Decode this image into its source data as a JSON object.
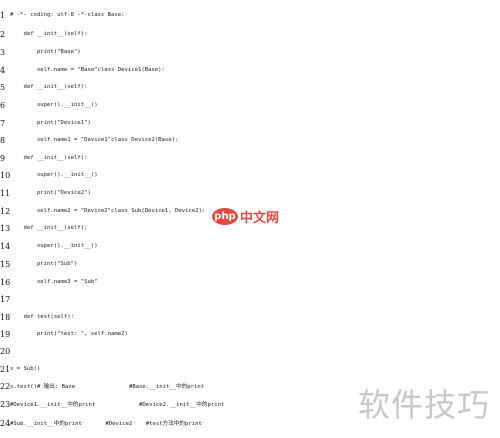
{
  "lines": [
    {
      "num": "1",
      "text": "# -*- coding: utf-8 -*-class Base:"
    },
    {
      "num": "2",
      "text": "    def __init__(self):"
    },
    {
      "num": "3",
      "text": "        print(\"Base\")"
    },
    {
      "num": "4",
      "text": "        self.name = \"Base\"class Device1(Base):"
    },
    {
      "num": "5",
      "text": "    def __init__(self):"
    },
    {
      "num": "6",
      "text": "        super().__init__()"
    },
    {
      "num": "7",
      "text": "        print(\"Device1\")"
    },
    {
      "num": "8",
      "text": "        self.name1 = \"Device1\"class Device2(Base):"
    },
    {
      "num": "9",
      "text": "    def __init__(self):"
    },
    {
      "num": "10",
      "text": "        super().__init__()"
    },
    {
      "num": "11",
      "text": "        print(\"Device2\")"
    },
    {
      "num": "12",
      "text": "        self.name2 = \"Device2\"class Sub(Device1, Device2):"
    },
    {
      "num": "13",
      "text": "    def __init__(self):"
    },
    {
      "num": "14",
      "text": "        super().__init__()"
    },
    {
      "num": "15",
      "text": "        print(\"Sub\")"
    },
    {
      "num": "16",
      "text": "        self.name3 = \"Sub\""
    },
    {
      "num": "17",
      "text": ""
    },
    {
      "num": "18",
      "text": "    def test(self):"
    },
    {
      "num": "19",
      "text": "        print(\"test: \", self.name2)"
    },
    {
      "num": "20",
      "text": ""
    },
    {
      "num": "21",
      "text": "s = Sub()"
    },
    {
      "num": "22",
      "text": "s.test()# 输出: Base                #Base.__init__中的print"
    },
    {
      "num": "23",
      "text": "#Device1.__init__中的print             #Device2.__init__中的print"
    },
    {
      "num": "24",
      "text": "#Sub.__init__中的print       #Device2    #test方法中的print"
    }
  ],
  "watermark_php": {
    "badge": "php",
    "text": "中文网"
  },
  "watermark_corner": "软件技巧"
}
